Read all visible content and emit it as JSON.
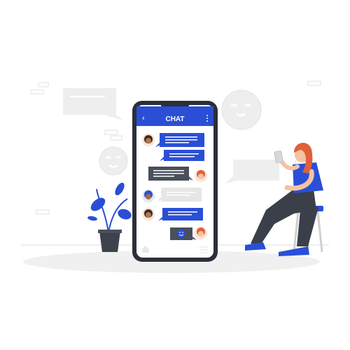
{
  "phone": {
    "title": "CHAT",
    "back_icon": "chevron-left-icon",
    "menu_icon": "kebab-menu-icon"
  },
  "colors": {
    "accent": "#2a4fd6",
    "phone_frame": "#2b2f3a",
    "bubble_gray": "#e6e6e6",
    "bubble_dark": "#4a4f5c",
    "skin_light": "#f4c3a3",
    "hair_red": "#e0603a",
    "pants": "#3a3f4a",
    "plant_pot": "#3d424d",
    "ground": "#f1f1f1"
  },
  "messages": [
    {
      "side": "left",
      "style": "accent",
      "lines": 3,
      "avatar": "woman-dark-hair"
    },
    {
      "side": "left",
      "style": "accent",
      "lines": 2,
      "avatar": "none"
    },
    {
      "side": "right",
      "style": "dark",
      "lines": 3,
      "avatar": "woman-red-hair"
    },
    {
      "side": "left",
      "style": "gray",
      "lines": 2,
      "avatar": "man-curly-hair"
    },
    {
      "side": "left",
      "style": "accent",
      "lines": 2,
      "avatar": "woman-dark-hair"
    },
    {
      "side": "right",
      "style": "dark",
      "lines": 0,
      "avatar": "woman-red-hair",
      "emoji": "smile-icon"
    }
  ]
}
